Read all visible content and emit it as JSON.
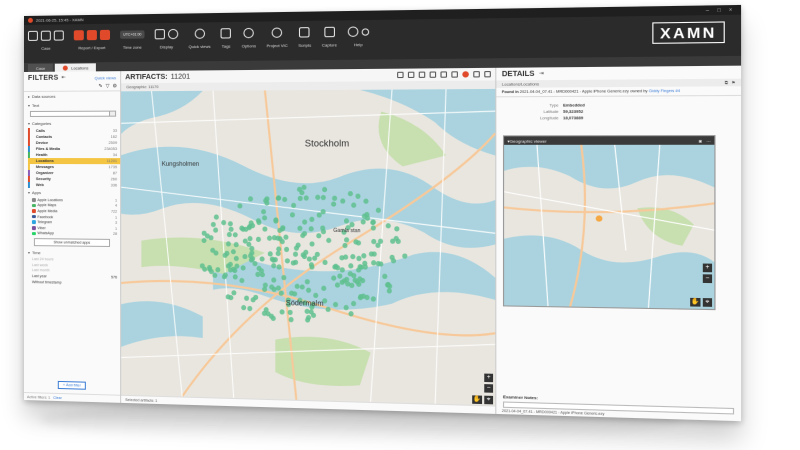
{
  "app": {
    "window_title": "2021-06-25, 15:45 - XAMN",
    "brand": "XAMN"
  },
  "ribbon": {
    "groups": [
      {
        "label": "Case",
        "icons": [
          "open-icon",
          "save-icon",
          "export-icon"
        ]
      },
      {
        "label": "Report / Export",
        "icons": [
          "report-icon",
          "print-icon",
          "export-pdf-icon"
        ]
      },
      {
        "label": "Time zone",
        "value": "UTC+01:00"
      },
      {
        "label": "Display",
        "icons": [
          "display-icon",
          "filter-icon"
        ]
      },
      {
        "label": "Quick views",
        "icons": [
          "eye-icon"
        ]
      },
      {
        "label": "Tags",
        "icons": [
          "tag-icon"
        ]
      },
      {
        "label": "Options",
        "icons": [
          "gear-icon"
        ]
      },
      {
        "label": "Project VIC",
        "icons": [
          "vic-icon"
        ]
      },
      {
        "label": "Scripts",
        "icons": [
          "scripts-icon"
        ]
      },
      {
        "label": "Capture",
        "icons": [
          "camera-icon"
        ]
      },
      {
        "label": "Help",
        "icons": [
          "help-icon",
          "info-icon"
        ]
      }
    ]
  },
  "tabs": [
    {
      "label": "Case",
      "active": false
    },
    {
      "label": "Locations",
      "active": true
    }
  ],
  "filters": {
    "title": "FILTERS",
    "quick_views": "Quick views",
    "data_sources": "Data sources",
    "text": "Text",
    "categories_label": "Categories",
    "categories": [
      {
        "name": "Calls",
        "count": "33",
        "color": "#e04a2b"
      },
      {
        "name": "Contacts",
        "count": "162",
        "color": "#e04a2b"
      },
      {
        "name": "Device",
        "count": "2509",
        "color": "#e04a2b"
      },
      {
        "name": "Files & Media",
        "count": "234053",
        "color": "#2c8fce"
      },
      {
        "name": "Health",
        "count": "34",
        "color": "#45b561"
      },
      {
        "name": "Locations",
        "count": "11201",
        "color": "#f4c542",
        "selected": true
      },
      {
        "name": "Messages",
        "count": "1735",
        "color": "#f4c542"
      },
      {
        "name": "Organizer",
        "count": "87",
        "color": "#8b5cb5"
      },
      {
        "name": "Security",
        "count": "260",
        "color": "#e04a2b"
      },
      {
        "name": "Web",
        "count": "336",
        "color": "#2c8fce"
      }
    ],
    "apps_label": "Apps",
    "apps": [
      {
        "name": "Apple Locations",
        "count": "1",
        "color": "#888888"
      },
      {
        "name": "Apple Maps",
        "count": "4",
        "color": "#45b561"
      },
      {
        "name": "Apple Media",
        "count": "722",
        "color": "#e04a2b"
      },
      {
        "name": "Facebook",
        "count": "1",
        "color": "#3b5998"
      },
      {
        "name": "Telegram",
        "count": "3",
        "color": "#2ca5e0"
      },
      {
        "name": "Viber",
        "count": "1",
        "color": "#7b519d"
      },
      {
        "name": "WhatsApp",
        "count": "28",
        "color": "#25d366"
      }
    ],
    "show_unmatched": "Show unmatched apps",
    "time_label": "Time",
    "times": [
      {
        "name": "Last 24 hours",
        "count": "",
        "active": false
      },
      {
        "name": "Last week",
        "count": "",
        "active": false
      },
      {
        "name": "Last month",
        "count": "",
        "active": false
      },
      {
        "name": "Last year",
        "count": "576",
        "active": true
      },
      {
        "name": "Without timestamp",
        "count": "",
        "active": true
      }
    ],
    "add_filter": "+ Add filter",
    "active_filters": "Active filters: 1",
    "clear": "Clear"
  },
  "artifacts": {
    "title": "ARTIFACTS:",
    "count": "11201",
    "geographic": "Geographic: 11170",
    "selected": "Selected artifacts: 1",
    "map_labels": [
      "Stockholm",
      "Södermalm",
      "Kungsholmen",
      "Gamla stan"
    ]
  },
  "details": {
    "title": "DETAILS",
    "path": "Locations/Locations",
    "found_in_label": "Found in",
    "found_in": "2021-04-04_07.41 - MRD000421 - Apple iPhone Generic.ezy",
    "owned_by": "owned by",
    "owner": "Giddy Fingers #4",
    "props": [
      {
        "k": "Type",
        "v": "Embedded"
      },
      {
        "k": "Latitude",
        "v": "59,323952"
      },
      {
        "k": "Longitude",
        "v": "18,073889"
      }
    ],
    "geo_viewer": "Geographic viewer",
    "examiner_notes": "Examiner Notes:",
    "bottom": "2021-04-04_07.41 - MRD000421 - Apple iPhone Generic.ezy"
  }
}
